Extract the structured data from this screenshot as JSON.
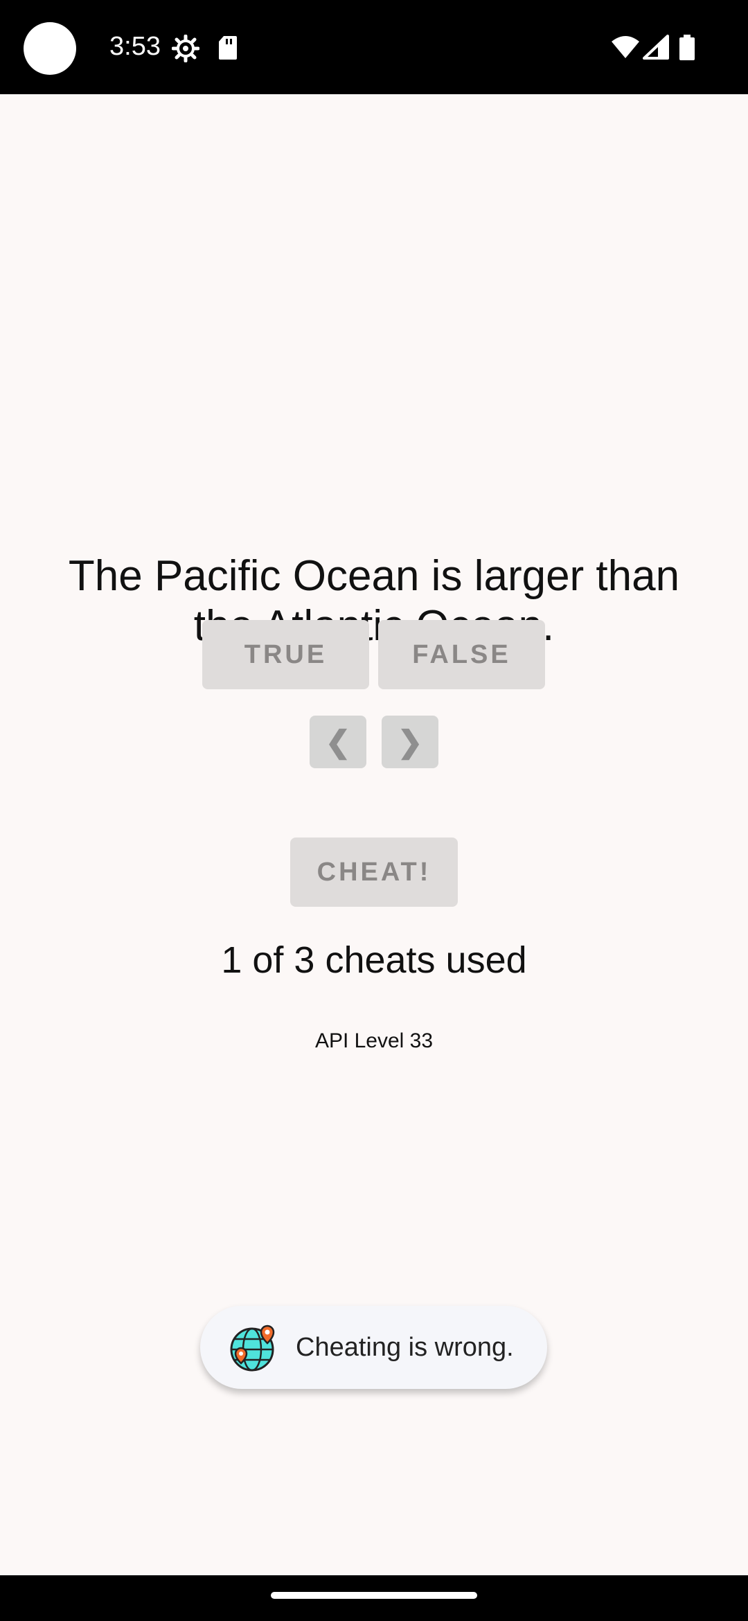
{
  "status_bar": {
    "time": "3:53",
    "icons": [
      "settings-icon",
      "sdcard-icon",
      "wifi-icon",
      "signal-icon",
      "battery-icon"
    ]
  },
  "quiz": {
    "question": "The Pacific Ocean is larger than the Atlantic Ocean.",
    "true_label": "TRUE",
    "false_label": "FALSE",
    "prev_label": "❮",
    "next_label": "❯",
    "cheat_label": "CHEAT!",
    "cheats_used": "1 of 3 cheats used",
    "api_level": "API Level 33"
  },
  "toast": {
    "message": "Cheating is wrong.",
    "icon": "globe-pins-icon"
  },
  "colors": {
    "background": "#fcf8f7",
    "button_bg": "#dfdcdb",
    "button_text": "#8a8786",
    "toast_bg": "#f5f6fa"
  }
}
